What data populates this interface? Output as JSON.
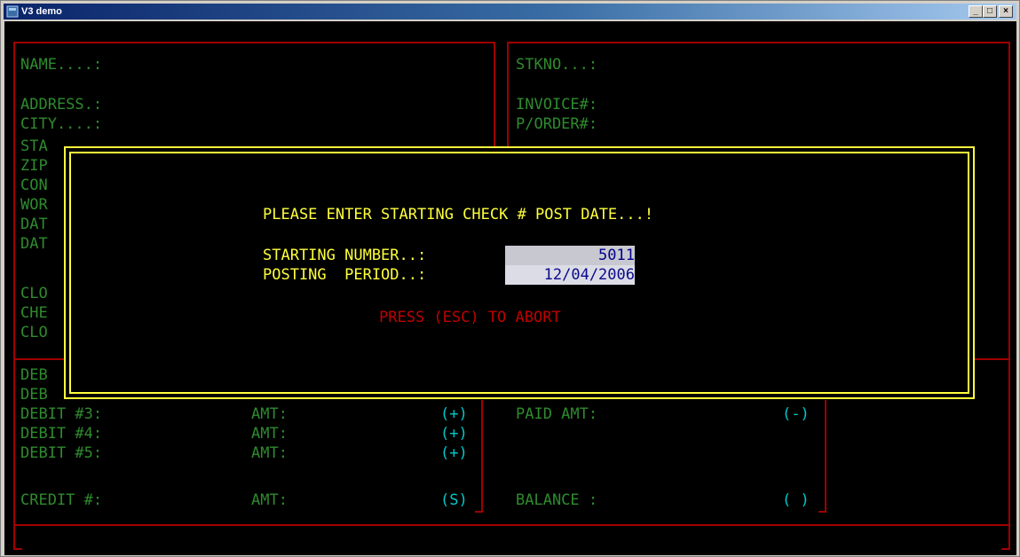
{
  "window": {
    "title": "V3 demo",
    "minimize": "_",
    "maximize": "□",
    "close": "×"
  },
  "form": {
    "name_label": "NAME....:",
    "address_label": "ADDRESS.:",
    "city_label": "CITY....:",
    "left_clipped": [
      "STA",
      "ZIP",
      "CON",
      "WOR",
      "DAT",
      "DAT",
      "",
      "CLO",
      "CHE",
      "CLO"
    ],
    "stkno_label": "STKNO...:",
    "invoice_label": "INVOICE#:",
    "porder_label": "P/ORDER#:",
    "deb1": "DEB",
    "deb2": "DEB",
    "debit3": "DEBIT #3:",
    "debit4": "DEBIT #4:",
    "debit5": "DEBIT #5:",
    "credit": "CREDIT #:",
    "amt": "AMT:",
    "plus": "(+)",
    "minus": "(-)",
    "s": "(S)",
    "blank": "( )",
    "paid_amt": "PAID AMT:",
    "balance": "BALANCE :"
  },
  "dialog": {
    "heading": "PLEASE ENTER STARTING CHECK # POST DATE...!",
    "starting_label": "STARTING NUMBER..:",
    "starting_value": "5011",
    "posting_label": "POSTING  PERIOD..:",
    "posting_value": "12/04/2006",
    "abort": "PRESS (ESC) TO ABORT"
  }
}
